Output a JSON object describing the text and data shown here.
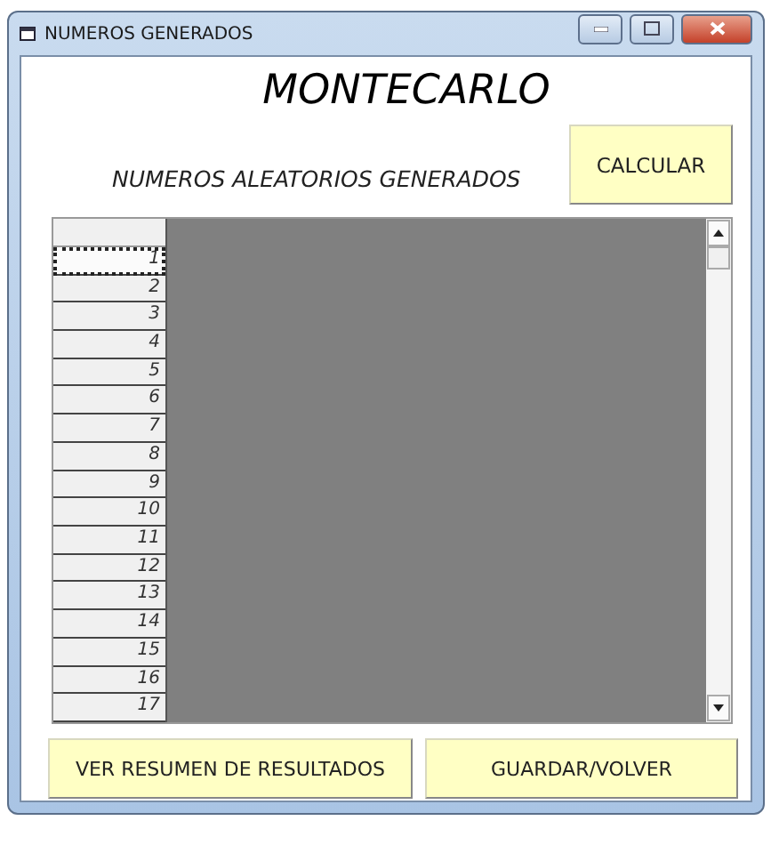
{
  "window": {
    "title": "NUMEROS GENERADOS"
  },
  "heading": "MONTECARLO",
  "subtitle": "NUMEROS ALEATORIOS GENERADOS",
  "calculate_button": "CALCULAR",
  "grid": {
    "rows": [
      {
        "label": "1",
        "selected": true
      },
      {
        "label": "2",
        "selected": false
      },
      {
        "label": "3",
        "selected": false
      },
      {
        "label": "4",
        "selected": false
      },
      {
        "label": "5",
        "selected": false
      },
      {
        "label": "6",
        "selected": false
      },
      {
        "label": "7",
        "selected": false
      },
      {
        "label": "8",
        "selected": false
      },
      {
        "label": "9",
        "selected": false
      },
      {
        "label": "10",
        "selected": false
      },
      {
        "label": "11",
        "selected": false
      },
      {
        "label": "12",
        "selected": false
      },
      {
        "label": "13",
        "selected": false
      },
      {
        "label": "14",
        "selected": false
      },
      {
        "label": "15",
        "selected": false
      },
      {
        "label": "16",
        "selected": false
      },
      {
        "label": "17",
        "selected": false
      }
    ]
  },
  "buttons": [
    "VER RESUMEN DE RESULTADOS",
    "GUARDAR/VOLVER"
  ]
}
